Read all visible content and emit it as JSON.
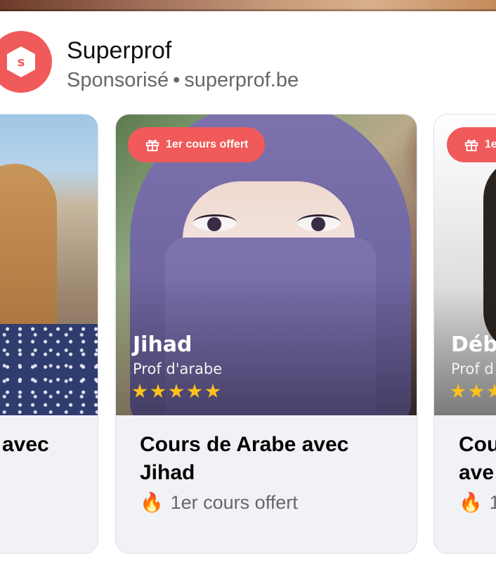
{
  "header": {
    "page_name": "Superprof",
    "sponsored_label": "Sponsorisé",
    "separator": "•",
    "domain": "superprof.be",
    "logo_letter": "s"
  },
  "carousel": {
    "cards": [
      {
        "title": "avec",
        "subtitle": ""
      },
      {
        "badge": "1er cours offert",
        "tutor_name": "Jihad",
        "tutor_role": "Prof d'arabe",
        "rating": 5,
        "title": "Cours de Arabe avec Jihad",
        "flame": "🔥",
        "subtitle": "1er cours offert"
      },
      {
        "badge": "1e",
        "tutor_name": "Déb",
        "tutor_role": "Prof d",
        "title": "Cou ave",
        "flame": "🔥",
        "subtitle": "1"
      }
    ]
  },
  "colors": {
    "brand": "#f15a5a",
    "star": "#ffc21a",
    "muted_text": "#65676b"
  }
}
